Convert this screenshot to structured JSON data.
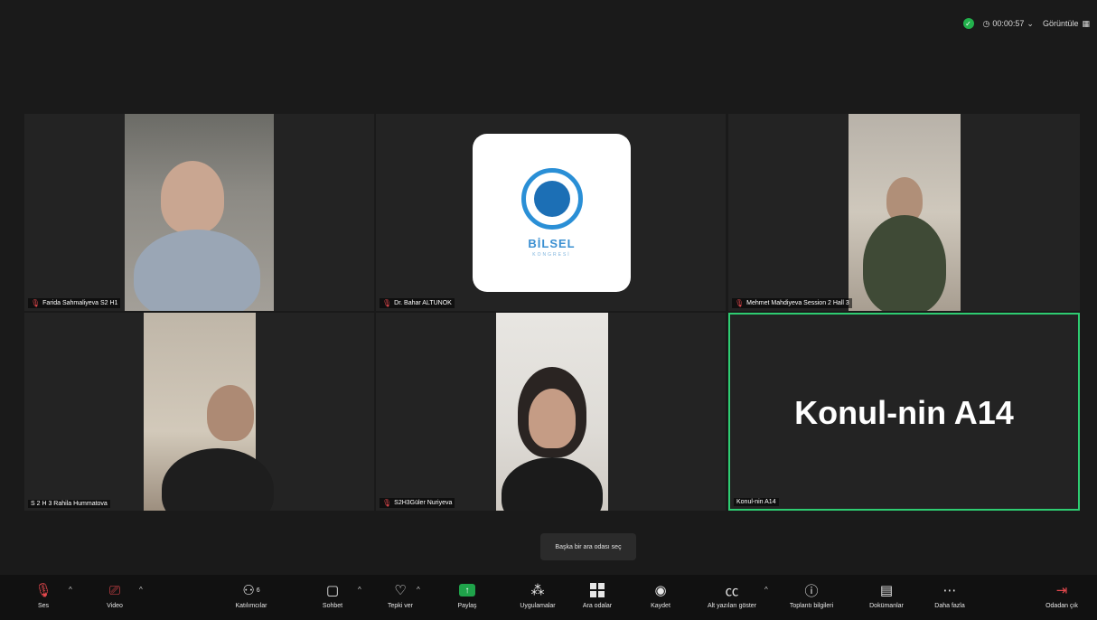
{
  "header": {
    "timer": "00:00:57",
    "view_label": "Görüntüle"
  },
  "participants": [
    {
      "name": "Farida Sahmaliyeva S2 H1",
      "muted": true
    },
    {
      "name": "Dr. Bahar ALTUNOK",
      "muted": true
    },
    {
      "name": "Mehmet Mahdiyeva Session 2 Hall 3",
      "muted": true
    },
    {
      "name": "S 2 H 3 Rahila Hummatova",
      "muted": false
    },
    {
      "name": "S2H3Güler Nuriyeva",
      "muted": true
    },
    {
      "name": "Konul-nin A14",
      "muted": false
    }
  ],
  "active_speaker": {
    "display_name": "Konul-nin A14"
  },
  "logo": {
    "name": "BİLSEL",
    "subtitle": "KONGRESİ"
  },
  "tooltip": "Başka bir ara odası seç",
  "toolbar": {
    "audio": "Ses",
    "video": "Video",
    "participants": "Katılımcılar",
    "participants_count": "6",
    "chat": "Sohbet",
    "react": "Tepki ver",
    "share": "Paylaş",
    "apps": "Uygulamalar",
    "breakout": "Ara odalar",
    "record": "Kaydet",
    "captions": "Alt yazıları göster",
    "info": "Toplantı bilgileri",
    "docs": "Dokümanlar",
    "more": "Daha fazla",
    "leave": "Odadan çık"
  },
  "colors": {
    "active_border": "#2ecc71",
    "muted": "#e5484d",
    "share": "#1fa34a"
  },
  "icons": [
    "shield-icon",
    "clock-icon",
    "grid-icon",
    "mic-muted-icon",
    "video-off-icon",
    "participants-icon",
    "chat-icon",
    "heart-icon",
    "share-icon",
    "apps-icon",
    "breakout-icon",
    "record-icon",
    "cc-icon",
    "info-icon",
    "document-icon",
    "more-icon",
    "leave-icon"
  ]
}
